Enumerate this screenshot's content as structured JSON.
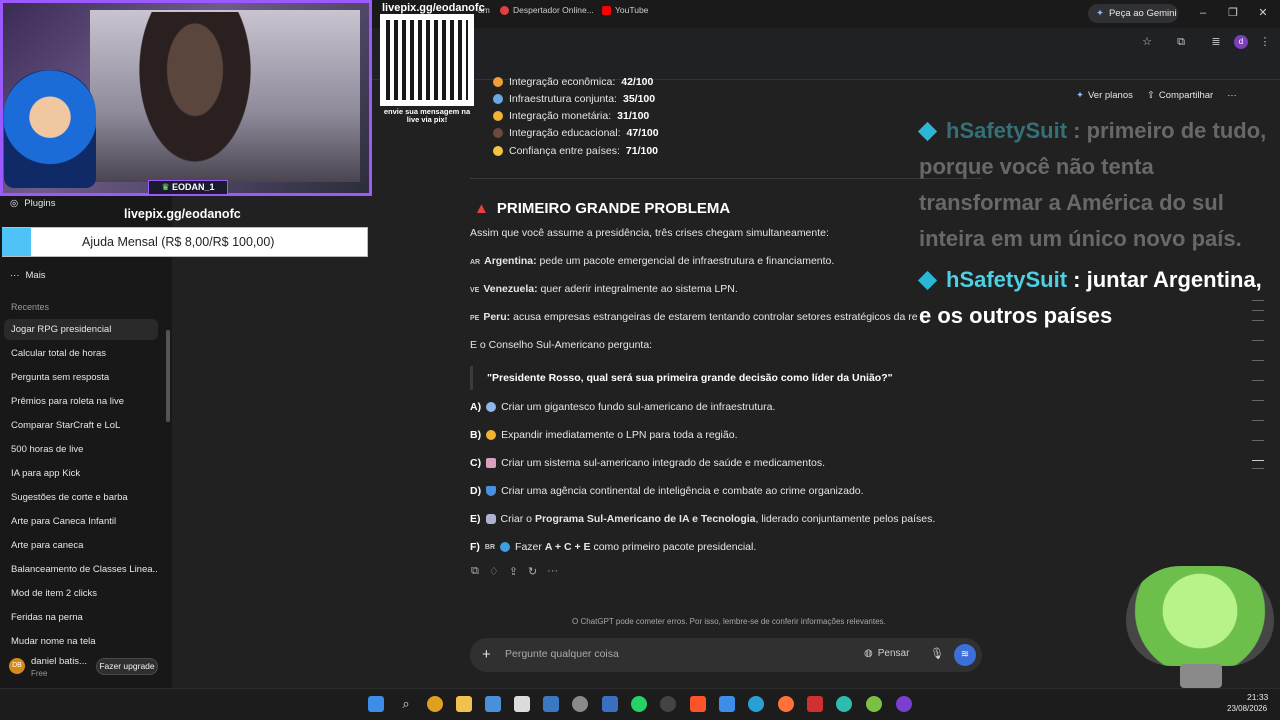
{
  "browser": {
    "gemini_button": "Peça ao Gemini",
    "profile_initial": "d",
    "bookmarks": [
      {
        "label": "am"
      },
      {
        "label": "Despertador Online..."
      },
      {
        "label": "YouTube"
      }
    ]
  },
  "sidebar": {
    "nav": [
      {
        "label": "Plugins"
      },
      {
        "label": "Mais"
      }
    ],
    "recent_label": "Recentes",
    "recents": [
      "Jogar RPG presidencial",
      "Calcular total de horas",
      "Pergunta sem resposta",
      "Prêmios para roleta na live",
      "Comparar StarCraft e LoL",
      "500 horas de live",
      "IA para app Kick",
      "Sugestões de corte e barba",
      "Arte para Caneca Infantil",
      "Arte para caneca",
      "Balanceamento de Classes Linea...",
      "Mod de item 2 clicks",
      "Feridas na perna",
      "Mudar nome na tela"
    ],
    "user": {
      "initials": "DB",
      "name": "daniel batis...",
      "plan": "Free",
      "upgrade": "Fazer upgrade"
    }
  },
  "header": {
    "plans": "Ver planos",
    "share": "Compartilhar"
  },
  "scores": [
    {
      "label": "Integração econômica:",
      "value": "42/100",
      "color": "#f0a030"
    },
    {
      "label": "Infraestrutura conjunta:",
      "value": "35/100",
      "color": "#6aa9e0"
    },
    {
      "label": "Integração monetária:",
      "value": "31/100",
      "color": "#f2b233"
    },
    {
      "label": "Integração educacional:",
      "value": "47/100",
      "color": "#6b4a3a"
    },
    {
      "label": "Confiança entre países:",
      "value": "71/100",
      "color": "#f5c542"
    }
  ],
  "section": {
    "title": "PRIMEIRO GRANDE PROBLEMA",
    "intro": "Assim que você assume a presidência, três crises chegam simultaneamente:",
    "crises": [
      {
        "flag": "AR",
        "name": "Argentina:",
        "text": "pede um pacote emergencial de infraestrutura e financiamento."
      },
      {
        "flag": "VE",
        "name": "Venezuela:",
        "text": "quer aderir integralmente ao sistema LPN."
      },
      {
        "flag": "PE",
        "name": "Peru:",
        "text": "acusa empresas estrangeiras de estarem tentando controlar setores estratégicos da regi"
      }
    ],
    "council": "E o Conselho Sul-Americano pergunta:",
    "quote": "\"Presidente Rosso, qual será sua primeira grande decisão como líder da União?\"",
    "options": [
      {
        "letter": "A)",
        "text": "Criar um gigantesco fundo sul-americano de infraestrutura.",
        "color": "#8fb8e8"
      },
      {
        "letter": "B)",
        "text": "Expandir imediatamente o LPN para toda a região.",
        "color": "#f2b233"
      },
      {
        "letter": "C)",
        "text": "Criar um sistema sul-americano integrado de saúde e medicamentos.",
        "color": "#d9a0c0"
      },
      {
        "letter": "D)",
        "text": "Criar uma agência continental de inteligência e combate ao crime organizado.",
        "color": "#4a8fe0"
      },
      {
        "letter": "E)",
        "pre": "Criar o ",
        "bold": "Programa Sul-Americano de IA e Tecnologia",
        "post": ", liderado conjuntamente pelos países.",
        "color": "#b0b0d0"
      },
      {
        "letter": "F)",
        "flag": "BR",
        "pre": "Fazer ",
        "bold": "A + C + E",
        "post": " como primeiro pacote presidencial.",
        "color": "#3aa0e0"
      }
    ]
  },
  "disclaimer": "O ChatGPT pode cometer erros. Por isso, lembre-se de conferir informações relevantes.",
  "composer": {
    "placeholder": "Pergunte qualquer coisa",
    "think": "Pensar"
  },
  "chat_overlay": [
    {
      "user": "hSafetySuit",
      "lines": [
        ": primeiro de tudo,",
        "porque você não tenta",
        "transformar a América do sul",
        "inteira em um único novo país."
      ]
    },
    {
      "user": "hSafetySuit",
      "lines": [
        ": juntar Argentina,",
        "e os outros países"
      ]
    }
  ],
  "stream": {
    "pix_url": "livepix.gg/eodanofc",
    "pix_caption": "envie sua mensagem na live via pix!",
    "cam_name": "EODAN_1",
    "donation_label": "Ajuda Mensal (R$ 8,00/R$ 100,00)",
    "donation_progress": 0.08
  },
  "clock": {
    "time": "21:33",
    "date": "23/08/2026"
  }
}
